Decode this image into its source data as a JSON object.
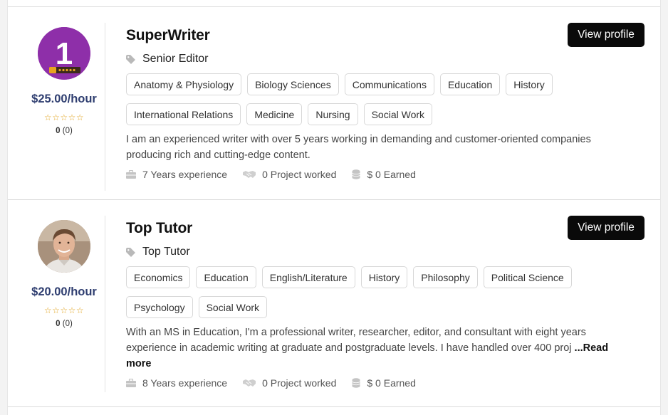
{
  "colors": {
    "rate": "#2f3e70",
    "star": "#e0a21b",
    "button_bg": "#0a0a0a",
    "avatar_purple": "#8e2fa9"
  },
  "profiles": [
    {
      "name": "SuperWriter",
      "avatar_digit": "1",
      "rate": "$25.00/hour",
      "stars": "☆☆☆☆☆",
      "rating_value": "0",
      "rating_count": "(0)",
      "button": "View profile",
      "role": "Senior Editor",
      "subjects": [
        "Anatomy & Physiology",
        "Biology Sciences",
        "Communications",
        "Education",
        "History",
        "International Relations",
        "Medicine",
        "Nursing",
        "Social Work"
      ],
      "description": "I am an experienced writer with over 5 years working in demanding and customer-oriented companies producing rich and cutting-edge content.",
      "experience": "7 Years experience",
      "projects": "0 Project worked",
      "earned": "$ 0 Earned"
    },
    {
      "name": "Top Tutor",
      "rate": "$20.00/hour",
      "stars": "☆☆☆☆☆",
      "rating_value": "0",
      "rating_count": "(0)",
      "button": "View profile",
      "role": "Top Tutor",
      "subjects": [
        "Economics",
        "Education",
        "English/Literature",
        "History",
        "Philosophy",
        "Political Science",
        "Psychology",
        "Social Work"
      ],
      "description": "With an MS in Education, I'm a professional writer, researcher, editor, and consultant with eight years experience in academic writing at graduate and postgraduate levels. I have handled over 400 proj",
      "read_more": "...Read more",
      "experience": "8 Years experience",
      "projects": "0 Project worked",
      "earned": "$ 0 Earned"
    }
  ]
}
